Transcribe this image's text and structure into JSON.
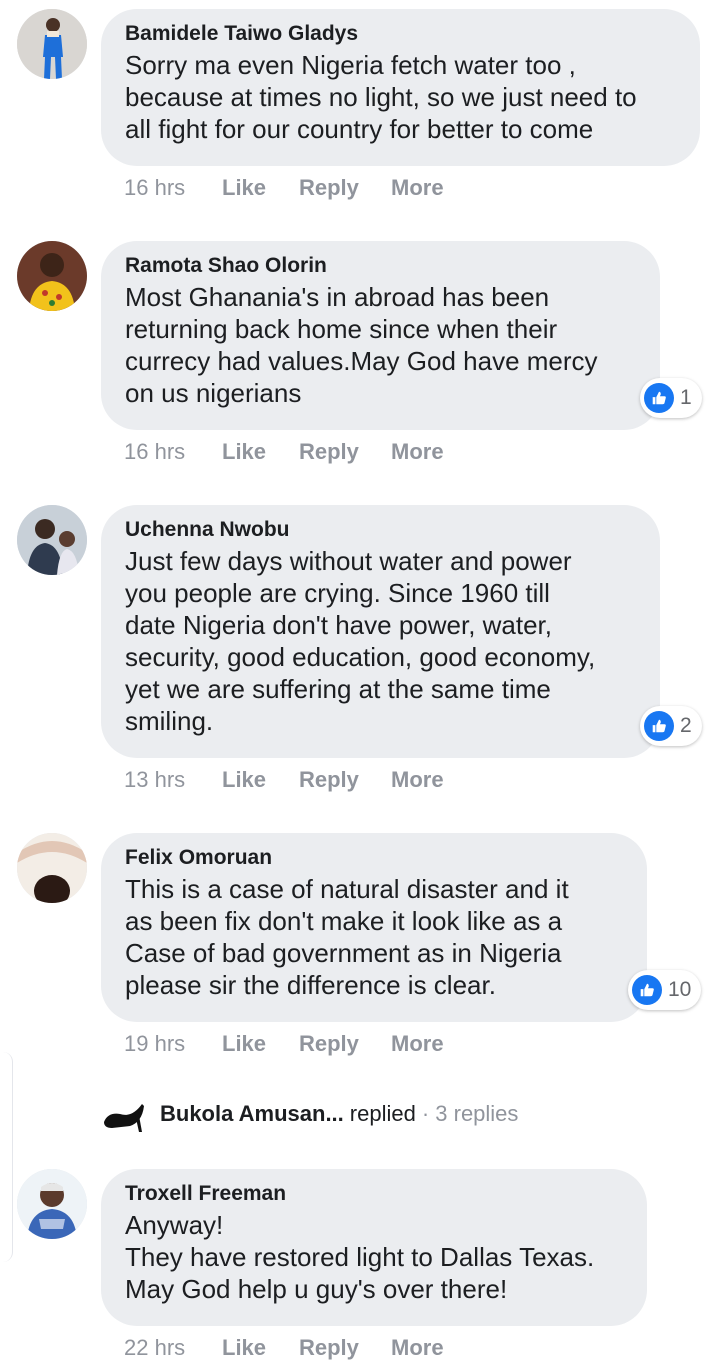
{
  "comments": [
    {
      "author": "Bamidele Taiwo Gladys",
      "text": "Sorry ma even Nigeria fetch water too ,\nbecause at times no light, so we just need to\nall fight for our country for better to come",
      "time": "16 hrs",
      "like": "Like",
      "reply": "Reply",
      "more": "More",
      "reactions": ""
    },
    {
      "author": "Ramota Shao Olorin",
      "text": "Most Ghanania's in abroad has been\nreturning back home since when their\ncurrecy had values.May God have mercy\non us nigerians",
      "time": "16 hrs",
      "like": "Like",
      "reply": "Reply",
      "more": "More",
      "reactions": "1"
    },
    {
      "author": "Uchenna Nwobu",
      "text": "Just few days without water and power\nyou people are crying. Since 1960 till\ndate Nigeria don't have power, water,\nsecurity, good education, good economy,\nyet we are suffering at the same time\nsmiling.",
      "time": "13 hrs",
      "like": "Like",
      "reply": "Reply",
      "more": "More",
      "reactions": "2"
    },
    {
      "author": "Felix Omoruan",
      "text": "This is a case of natural disaster and it\nas been fix don't make it look like as a\nCase of bad government as in Nigeria\nplease sir the difference is clear.",
      "time": "19 hrs",
      "like": "Like",
      "reply": "Reply",
      "more": "More",
      "reactions": "10"
    },
    {
      "author": "Troxell Freeman",
      "text": "Anyway!\nThey have restored light to Dallas Texas.\nMay God help u guy's over there!",
      "time": "22 hrs",
      "like": "Like",
      "reply": "Reply",
      "more": "More",
      "reactions": ""
    }
  ],
  "replies_summary": {
    "name": "Bukola Amusan...",
    "action": "replied",
    "count": "· 3 replies"
  },
  "colors": {
    "bubble": "#ebedf0",
    "meta": "#90949c",
    "like_blue": "#1877f2"
  }
}
